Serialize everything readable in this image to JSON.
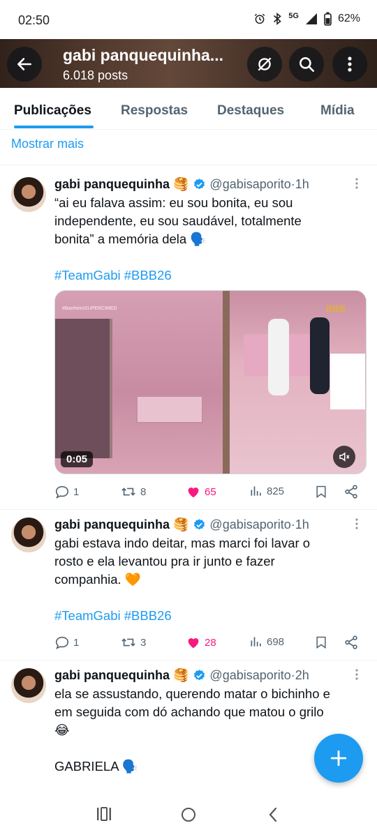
{
  "status_bar": {
    "time": "02:50",
    "network": "5G",
    "battery": "62%"
  },
  "header": {
    "title": "gabi panquequinha...",
    "posts": "6.018 posts"
  },
  "tabs": [
    {
      "label": "Publicações",
      "active": true
    },
    {
      "label": "Respostas",
      "active": false
    },
    {
      "label": "Destaques",
      "active": false
    },
    {
      "label": "Mídia",
      "active": false
    }
  ],
  "show_more": "Mostrar mais",
  "tweets": [
    {
      "name": "gabi panquequinha 🥞",
      "handle": "@gabisaporito",
      "sep": " · ",
      "time": "1h",
      "text": "“ai eu falava assim: eu sou bonita, eu sou\nindependente, eu sou saudável, totalmente\nbonita” a memória dela 🗣️",
      "hashtags": "#TeamGabi #BBB26",
      "media": {
        "duration": "0:05",
        "caption": "#BanheiroSUPERCIMED",
        "logo": "BBB"
      },
      "replies": "1",
      "reposts": "8",
      "likes": "65",
      "views": "825"
    },
    {
      "name": "gabi panquequinha 🥞",
      "handle": "@gabisaporito",
      "sep": " · ",
      "time": "1h",
      "text": "gabi estava indo deitar, mas marci foi lavar o\nrosto e ela levantou pra ir junto e fazer\ncompanhia. 🧡",
      "hashtags": "#TeamGabi #BBB26",
      "replies": "1",
      "reposts": "3",
      "likes": "28",
      "views": "698"
    },
    {
      "name": "gabi panquequinha 🥞",
      "handle": "@gabisaporito",
      "sep": " · ",
      "time": "2h",
      "text": "ela se assustando, querendo matar o bichinho e\nem seguida com dó achando que matou o grilo\n😂\n\nGABRIELA 🗣️"
    }
  ],
  "colors": {
    "accent": "#1d9bf0",
    "like": "#f91880",
    "muted": "#536471",
    "text": "#0f1419"
  }
}
